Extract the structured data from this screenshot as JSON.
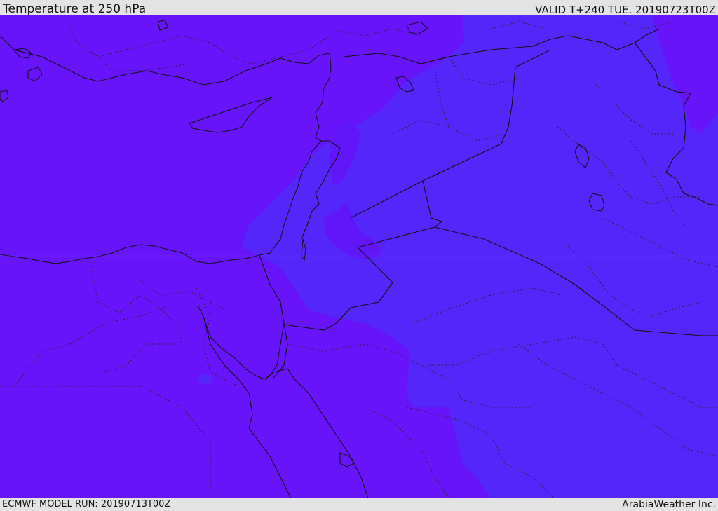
{
  "header": {
    "title": "Temperature at 250 hPa",
    "valid": "VALID T+240 TUE. 20190723T00Z"
  },
  "footer": {
    "model_run": "ECMWF MODEL RUN: 20190713T00Z",
    "brand": "ArabiaWeather Inc."
  },
  "map": {
    "field": "temperature-250hPa",
    "colors": {
      "cold_region": "#6714fa",
      "warm_region": "#5526fa",
      "coastline": "#111111",
      "border": "#111111",
      "province_border": "#222222"
    }
  }
}
